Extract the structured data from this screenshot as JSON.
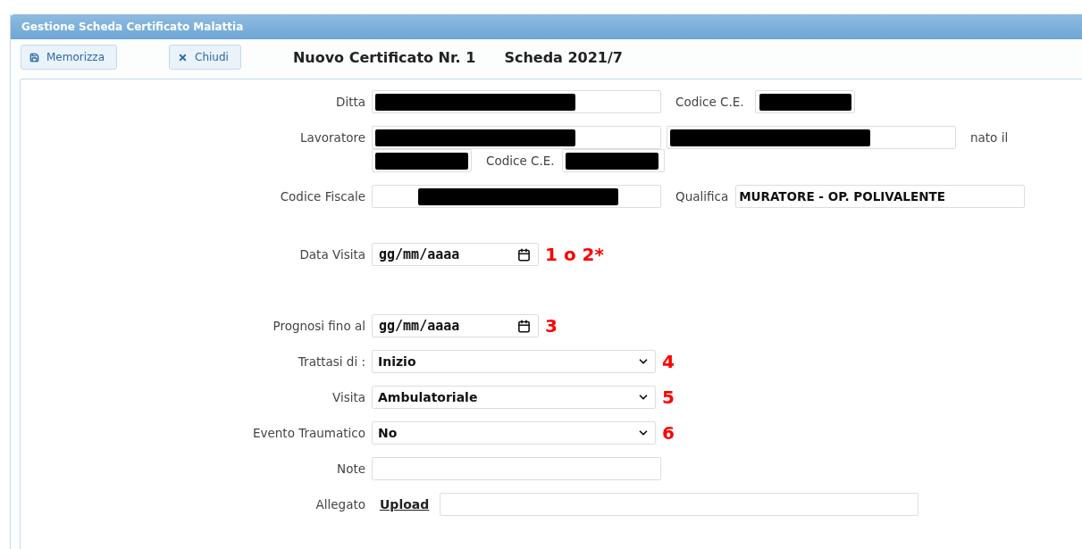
{
  "window": {
    "title": "Gestione Scheda Certificato Malattia"
  },
  "toolbar": {
    "buttons": [
      {
        "label": "Memorizza"
      },
      {
        "label": "Chiudi"
      }
    ],
    "headings": [
      "Nuovo Certificato Nr. 1",
      "Scheda 2021/7"
    ]
  },
  "form": {
    "ditta": {
      "label": "Ditta",
      "redacted": true
    },
    "ditta_code": {
      "label": "Codice C.E.",
      "redacted": true
    },
    "lavoratore": {
      "label": "Lavoratore",
      "redacted": true
    },
    "lavoratore_2": {
      "redacted": true
    },
    "born": {
      "label": "nato il",
      "redacted": true
    },
    "lavoratore_code": {
      "label": "Codice C.E.",
      "redacted": true
    },
    "codice_fiscale": {
      "label": "Codice Fiscale",
      "redacted": true
    },
    "qualifica": {
      "label": "Qualifica",
      "value": "MURATORE - OP. POLIVALENTE"
    },
    "data_visita": {
      "label": "Data Visita",
      "placeholder": "gg/mm/aaaa",
      "note": "1 o 2*"
    },
    "prognosi": {
      "label": "Prognosi fino al",
      "placeholder": "gg/mm/aaaa",
      "note": "3"
    },
    "selects": [
      {
        "label": "Trattasi di :",
        "value": "Inizio",
        "note": "4"
      },
      {
        "label": "Visita",
        "value": "Ambulatoriale",
        "note": "5"
      },
      {
        "label": "Evento Traumatico",
        "value": "No",
        "note": "6"
      }
    ],
    "note": {
      "label": "Note"
    },
    "allegato": {
      "label": "Allegato",
      "link": "Upload"
    }
  }
}
